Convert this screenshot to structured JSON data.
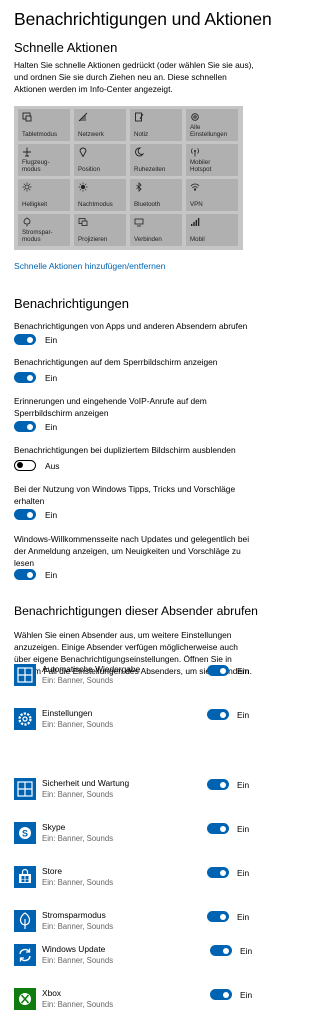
{
  "page_title": "Benachrichtigungen und Aktionen",
  "quick_actions": {
    "heading": "Schnelle Aktionen",
    "description": "Halten Sie schnelle Aktionen gedrückt (oder wählen Sie sie aus), und ordnen Sie sie durch Ziehen neu an. Diese schnellen Aktionen werden im Info-Center angezeigt.",
    "tiles": [
      {
        "label": "Tabletmodus",
        "icon": "tablet-mode-icon"
      },
      {
        "label": "Netzwerk",
        "icon": "network-icon"
      },
      {
        "label": "Notiz",
        "icon": "note-icon"
      },
      {
        "label": "Alle Einstellungen",
        "icon": "gear-icon"
      },
      {
        "label": "Flugzeug-modus",
        "icon": "airplane-icon"
      },
      {
        "label": "Position",
        "icon": "location-icon"
      },
      {
        "label": "Ruhezeiten",
        "icon": "moon-icon"
      },
      {
        "label": "Mobiler Hotspot",
        "icon": "hotspot-icon"
      },
      {
        "label": "Helligkeit",
        "icon": "brightness-icon"
      },
      {
        "label": "Nachtmodus",
        "icon": "night-light-icon"
      },
      {
        "label": "Bluetooth",
        "icon": "bluetooth-icon"
      },
      {
        "label": "VPN",
        "icon": "vpn-icon"
      },
      {
        "label": "Stromspar-modus",
        "icon": "battery-saver-icon"
      },
      {
        "label": "Projizieren",
        "icon": "project-icon"
      },
      {
        "label": "Verbinden",
        "icon": "connect-icon"
      },
      {
        "label": "Mobil",
        "icon": "cellular-icon"
      }
    ],
    "link": "Schnelle Aktionen hinzufügen/entfernen"
  },
  "notifications": {
    "heading": "Benachrichtigungen",
    "settings": [
      {
        "label": "Benachrichtigungen von Apps und anderen Absendern abrufen",
        "state": "Ein",
        "on": true
      },
      {
        "label": "Benachrichtigungen auf dem Sperrbildschirm anzeigen",
        "state": "Ein",
        "on": true
      },
      {
        "label": "Erinnerungen und eingehende VoIP-Anrufe auf dem Sperrbildschirm anzeigen",
        "state": "Ein",
        "on": true
      },
      {
        "label": "Benachrichtigungen bei dupliziertem Bildschirm ausblenden",
        "state": "Aus",
        "on": false
      },
      {
        "label": "Bei der Nutzung von Windows Tipps, Tricks und Vorschläge erhalten",
        "state": "Ein",
        "on": true
      },
      {
        "label": "Windows-Willkommensseite nach Updates und gelegentlich bei der Anmeldung anzeigen, um Neuigkeiten und Vorschläge zu lesen",
        "state": "Ein",
        "on": true
      }
    ]
  },
  "senders": {
    "heading": "Benachrichtigungen dieser Absender abrufen",
    "description": "Wählen Sie einen Absender aus, um weitere Einstellungen anzuzeigen. Einige Absender verfügen möglicherweise auch über eigene Benachrichtigungseinstellungen. Öffnen Sie in diesem Fall die Einstellungen des Absenders, um sie zu ändern.",
    "items": [
      {
        "name": "Automatische Wiedergabe",
        "sub": "Ein: Banner, Sounds",
        "state": "Ein",
        "icon": "autoplay-icon",
        "color": "#0063b1"
      },
      {
        "name": "Einstellungen",
        "sub": "Ein: Banner, Sounds",
        "state": "Ein",
        "icon": "settings-icon",
        "color": "#0063b1"
      },
      {
        "name": "Sicherheit und Wartung",
        "sub": "Ein: Banner, Sounds",
        "state": "Ein",
        "icon": "security-maintenance-icon",
        "color": "#0063b1"
      },
      {
        "name": "Skype",
        "sub": "Ein: Banner, Sounds",
        "state": "Ein",
        "icon": "skype-icon",
        "color": "#0063b1"
      },
      {
        "name": "Store",
        "sub": "Ein: Banner, Sounds",
        "state": "Ein",
        "icon": "store-icon",
        "color": "#0063b1"
      },
      {
        "name": "Stromsparmodus",
        "sub": "Ein: Banner, Sounds",
        "state": "Ein",
        "icon": "battery-saver-icon",
        "color": "#0063b1"
      },
      {
        "name": "Windows Update",
        "sub": "Ein: Banner, Sounds",
        "state": "Ein",
        "icon": "windows-update-icon",
        "color": "#0063b1"
      },
      {
        "name": "Xbox",
        "sub": "Ein: Banner, Sounds",
        "state": "Ein",
        "icon": "xbox-icon",
        "color": "#107c10"
      }
    ]
  },
  "colors": {
    "accent": "#0063b1",
    "xbox": "#107c10"
  }
}
